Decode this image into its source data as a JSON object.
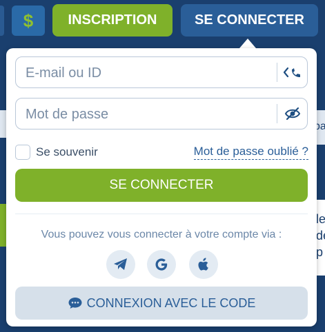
{
  "header": {
    "inscription_label": "INSCRIPTION",
    "connect_label": "SE CONNECTER",
    "dollar_symbol": "$"
  },
  "login": {
    "email_placeholder": "E-mail ou ID",
    "password_placeholder": "Mot de passe",
    "remember_label": "Se souvenir",
    "forgot_label": "Mot de passe oublié ?",
    "submit_label": "SE CONNECTER",
    "via_text": "Vous pouvez vous connecter à votre compte via :",
    "code_label": "CONNEXION AVEC LE CODE",
    "social_icons": [
      "telegram-icon",
      "google-icon",
      "apple-icon"
    ]
  },
  "background": {
    "side_fragments": [
      "pa",
      "le",
      "de",
      "p"
    ]
  },
  "colors": {
    "brand_blue": "#1a3f6e",
    "accent_green": "#7fb12a",
    "link_blue": "#2a5e98"
  }
}
